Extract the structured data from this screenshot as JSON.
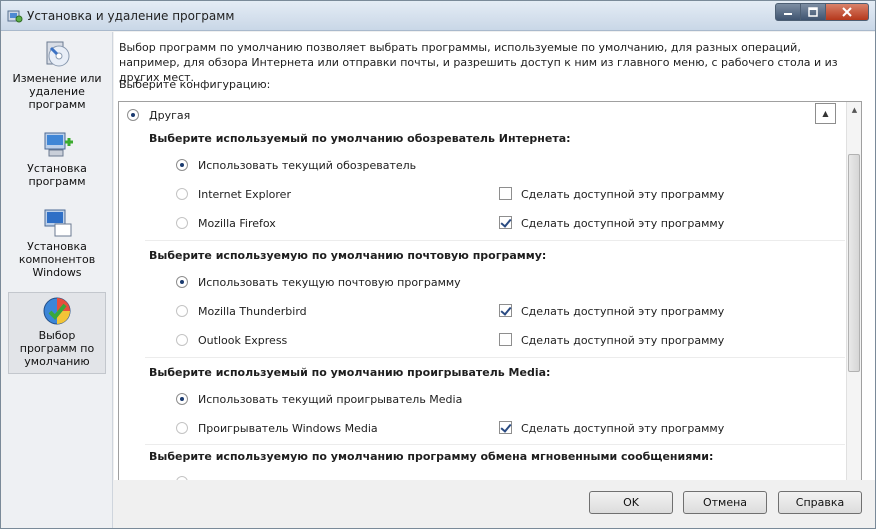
{
  "window": {
    "title": "Установка и удаление программ"
  },
  "sidebar": {
    "items": [
      {
        "label": "Изменение или удаление программ"
      },
      {
        "label": "Установка программ"
      },
      {
        "label": "Установка компонентов Windows"
      },
      {
        "label": "Выбор программ по умолчанию"
      }
    ]
  },
  "content": {
    "description": "Выбор программ по умолчанию позволяет выбрать программы, используемые по умолчанию, для разных операций, например, для обзора Интернета или отправки почты, и разрешить доступ к ним из главного меню, с рабочего стола и из других мест.",
    "config_label": "Выберите конфигурацию:",
    "config_option": "Другая",
    "sections": [
      {
        "header": "Выберите используемый по умолчанию обозреватель Интернета:",
        "current": "Использовать текущий обозреватель",
        "options": [
          {
            "name": "Internet Explorer",
            "make_available": "Сделать доступной эту программу",
            "checked": false
          },
          {
            "name": "Mozilla Firefox",
            "make_available": "Сделать доступной эту программу",
            "checked": true
          }
        ]
      },
      {
        "header": "Выберите используемую по умолчанию почтовую программу:",
        "current": "Использовать текущую почтовую программу",
        "options": [
          {
            "name": "Mozilla Thunderbird",
            "make_available": "Сделать доступной эту программу",
            "checked": true
          },
          {
            "name": "Outlook Express",
            "make_available": "Сделать доступной эту программу",
            "checked": false
          }
        ]
      },
      {
        "header": "Выберите используемый по умолчанию проигрыватель Media:",
        "current": "Использовать текущий проигрыватель Media",
        "options": [
          {
            "name": "Проигрыватель Windows Media",
            "make_available": "Сделать доступной эту программу",
            "checked": true
          }
        ]
      },
      {
        "header": "Выберите используемую по умолчанию программу обмена мгновенными сообщениями:"
      }
    ]
  },
  "buttons": {
    "ok": "OK",
    "cancel": "Отмена",
    "help": "Справка"
  },
  "colors": {
    "accent": "#1b3b6f",
    "titlebar": "#c9d7e7",
    "close": "#b5381c"
  }
}
